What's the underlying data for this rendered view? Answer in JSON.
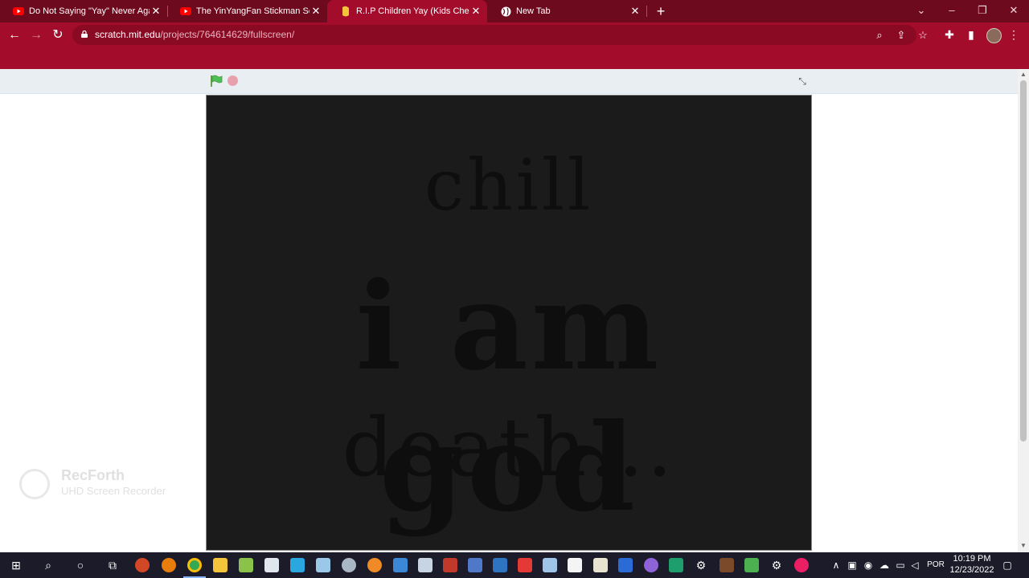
{
  "browser": {
    "tabs": [
      {
        "title": "Do Not Saying \"Yay\" Never Again",
        "favicon": "youtube-icon",
        "active": false
      },
      {
        "title": "The YinYangFan Stickman Sees a",
        "favicon": "youtube-icon",
        "active": false
      },
      {
        "title": "R.I.P Children Yay (Kids Cheering)",
        "favicon": "scratch-icon",
        "active": true
      },
      {
        "title": "New Tab",
        "favicon": "globe-icon",
        "active": false
      }
    ],
    "url_host": "scratch.mit.edu",
    "url_path": "/projects/764614629/fullscreen/",
    "accent_color": "#a40c2c"
  },
  "stage": {
    "line1": "chill",
    "line2": "i am god",
    "line3": "death...",
    "background_color": "#1b1b1b"
  },
  "watermark": {
    "name": "RecForth",
    "subtitle": "UHD Screen Recorder"
  },
  "taskbar": {
    "language": "POR",
    "time": "10:19 PM",
    "date": "12/23/2022"
  }
}
